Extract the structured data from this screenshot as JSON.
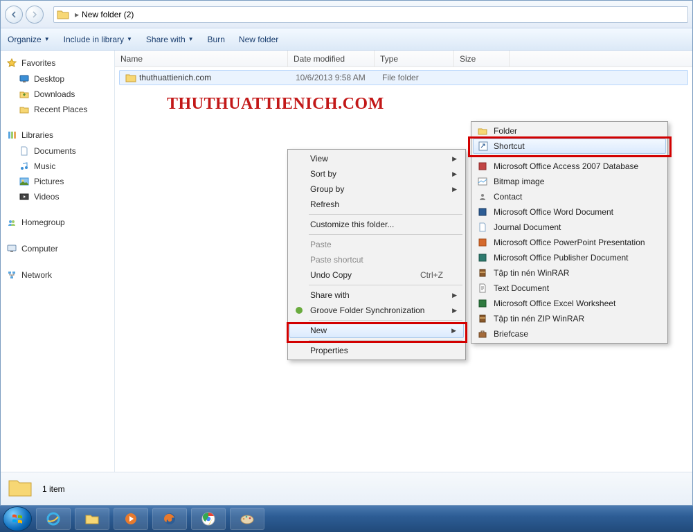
{
  "breadcrumb": {
    "location": "New folder (2)"
  },
  "toolbar": {
    "organize": "Organize",
    "include": "Include in library",
    "share": "Share with",
    "burn": "Burn",
    "newfolder": "New folder"
  },
  "sidebar": {
    "favorites": {
      "title": "Favorites",
      "items": [
        "Desktop",
        "Downloads",
        "Recent Places"
      ]
    },
    "libraries": {
      "title": "Libraries",
      "items": [
        "Documents",
        "Music",
        "Pictures",
        "Videos"
      ]
    },
    "homegroup": "Homegroup",
    "computer": "Computer",
    "network": "Network"
  },
  "columns": {
    "name": "Name",
    "date": "Date modified",
    "type": "Type",
    "size": "Size"
  },
  "files": {
    "row0": {
      "name": "thuthuattienich.com",
      "date": "10/6/2013 9:58 AM",
      "type": "File folder"
    }
  },
  "watermark": "THUTHUATTIENICH.COM",
  "ctx_left": {
    "view": "View",
    "sortby": "Sort by",
    "groupby": "Group by",
    "refresh": "Refresh",
    "customize": "Customize this folder...",
    "paste": "Paste",
    "pastesc": "Paste shortcut",
    "undo": "Undo Copy",
    "undo_key": "Ctrl+Z",
    "sharewith": "Share with",
    "groove": "Groove Folder Synchronization",
    "new": "New",
    "properties": "Properties"
  },
  "ctx_right": {
    "folder": "Folder",
    "shortcut": "Shortcut",
    "access": "Microsoft Office Access 2007 Database",
    "bitmap": "Bitmap image",
    "contact": "Contact",
    "word": "Microsoft Office Word Document",
    "journal": "Journal Document",
    "ppt": "Microsoft Office PowerPoint Presentation",
    "publisher": "Microsoft Office Publisher Document",
    "rar": "Tập tin nén WinRAR",
    "text": "Text Document",
    "excel": "Microsoft Office Excel Worksheet",
    "zip": "Tập tin nén ZIP WinRAR",
    "briefcase": "Briefcase"
  },
  "status": {
    "count": "1 item"
  }
}
